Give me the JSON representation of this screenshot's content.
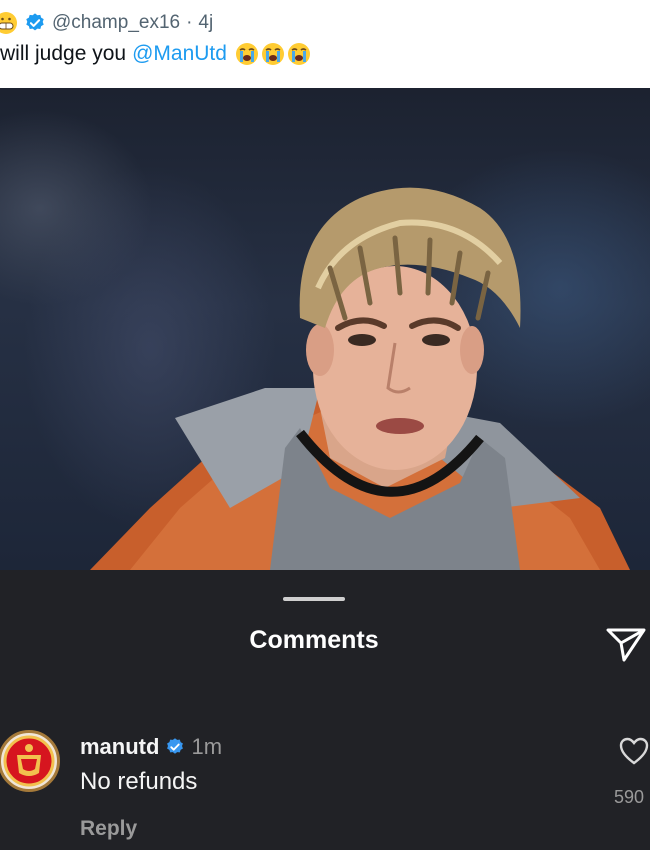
{
  "tweet": {
    "handle": "@champ_ex16",
    "separator": "·",
    "time": "4j",
    "text_prefix": "will judge you",
    "mention": "@ManUtd",
    "emoji_count": 3
  },
  "comments_sheet": {
    "title": "Comments",
    "comment": {
      "username": "manutd",
      "time": "1m",
      "text": "No refunds",
      "reply_label": "Reply",
      "likes": "590"
    }
  },
  "colors": {
    "mention": "#1d9bf0",
    "verified": "#1d9bf0",
    "sheet_bg": "#212226",
    "secondary_text": "#9a9a9a"
  },
  "icons": [
    "grinning-face-emoji-icon",
    "verified-badge-icon",
    "crying-face-emoji-icon",
    "send-icon",
    "heart-icon",
    "manutd-crest-icon"
  ]
}
